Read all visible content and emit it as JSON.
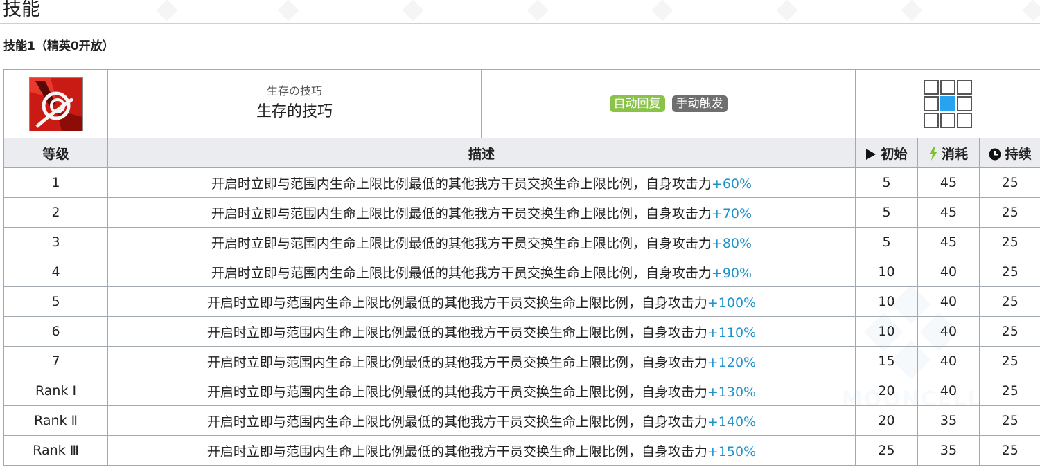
{
  "page": {
    "title": "技能"
  },
  "skill": {
    "heading": "技能1（精英0开放）",
    "name_jp": "生存の技巧",
    "name_cn": "生存的技巧",
    "tags": [
      {
        "label": "自动回复",
        "color": "#8bc34a"
      },
      {
        "label": "手动触发",
        "color": "#6f6f6f"
      }
    ],
    "range_grid": [
      0,
      0,
      0,
      0,
      1,
      0,
      0,
      0,
      0
    ],
    "icon": "skill-icon-red-white-swirl"
  },
  "table": {
    "headers": {
      "level": "等级",
      "description": "描述",
      "initial": "初始",
      "cost": "消耗",
      "duration": "持续"
    },
    "header_icons": {
      "initial": "play-icon",
      "cost": "lightning-icon",
      "duration": "clock-icon"
    },
    "description_text": "开启时立即与范围内生命上限比例最低的其他我方干员交换生命上限比例，自身攻击力",
    "rows": [
      {
        "level": "1",
        "bonus": "+60%",
        "initial": "5",
        "cost": "45",
        "duration": "25"
      },
      {
        "level": "2",
        "bonus": "+70%",
        "initial": "5",
        "cost": "45",
        "duration": "25"
      },
      {
        "level": "3",
        "bonus": "+80%",
        "initial": "5",
        "cost": "45",
        "duration": "25"
      },
      {
        "level": "4",
        "bonus": "+90%",
        "initial": "10",
        "cost": "40",
        "duration": "25"
      },
      {
        "level": "5",
        "bonus": "+100%",
        "initial": "10",
        "cost": "40",
        "duration": "25"
      },
      {
        "level": "6",
        "bonus": "+110%",
        "initial": "10",
        "cost": "40",
        "duration": "25"
      },
      {
        "level": "7",
        "bonus": "+120%",
        "initial": "15",
        "cost": "40",
        "duration": "25"
      },
      {
        "level": "Rank Ⅰ",
        "bonus": "+130%",
        "initial": "20",
        "cost": "40",
        "duration": "25"
      },
      {
        "level": "Rank Ⅱ",
        "bonus": "+140%",
        "initial": "20",
        "cost": "35",
        "duration": "25"
      },
      {
        "level": "Rank Ⅲ",
        "bonus": "+150%",
        "initial": "25",
        "cost": "35",
        "duration": "25"
      }
    ]
  },
  "watermark": {
    "text": "MOONCELL"
  },
  "colors": {
    "accent_value": "#1e93cc",
    "range_active": "#27a3ef",
    "header_bg": "#eaecf0"
  }
}
